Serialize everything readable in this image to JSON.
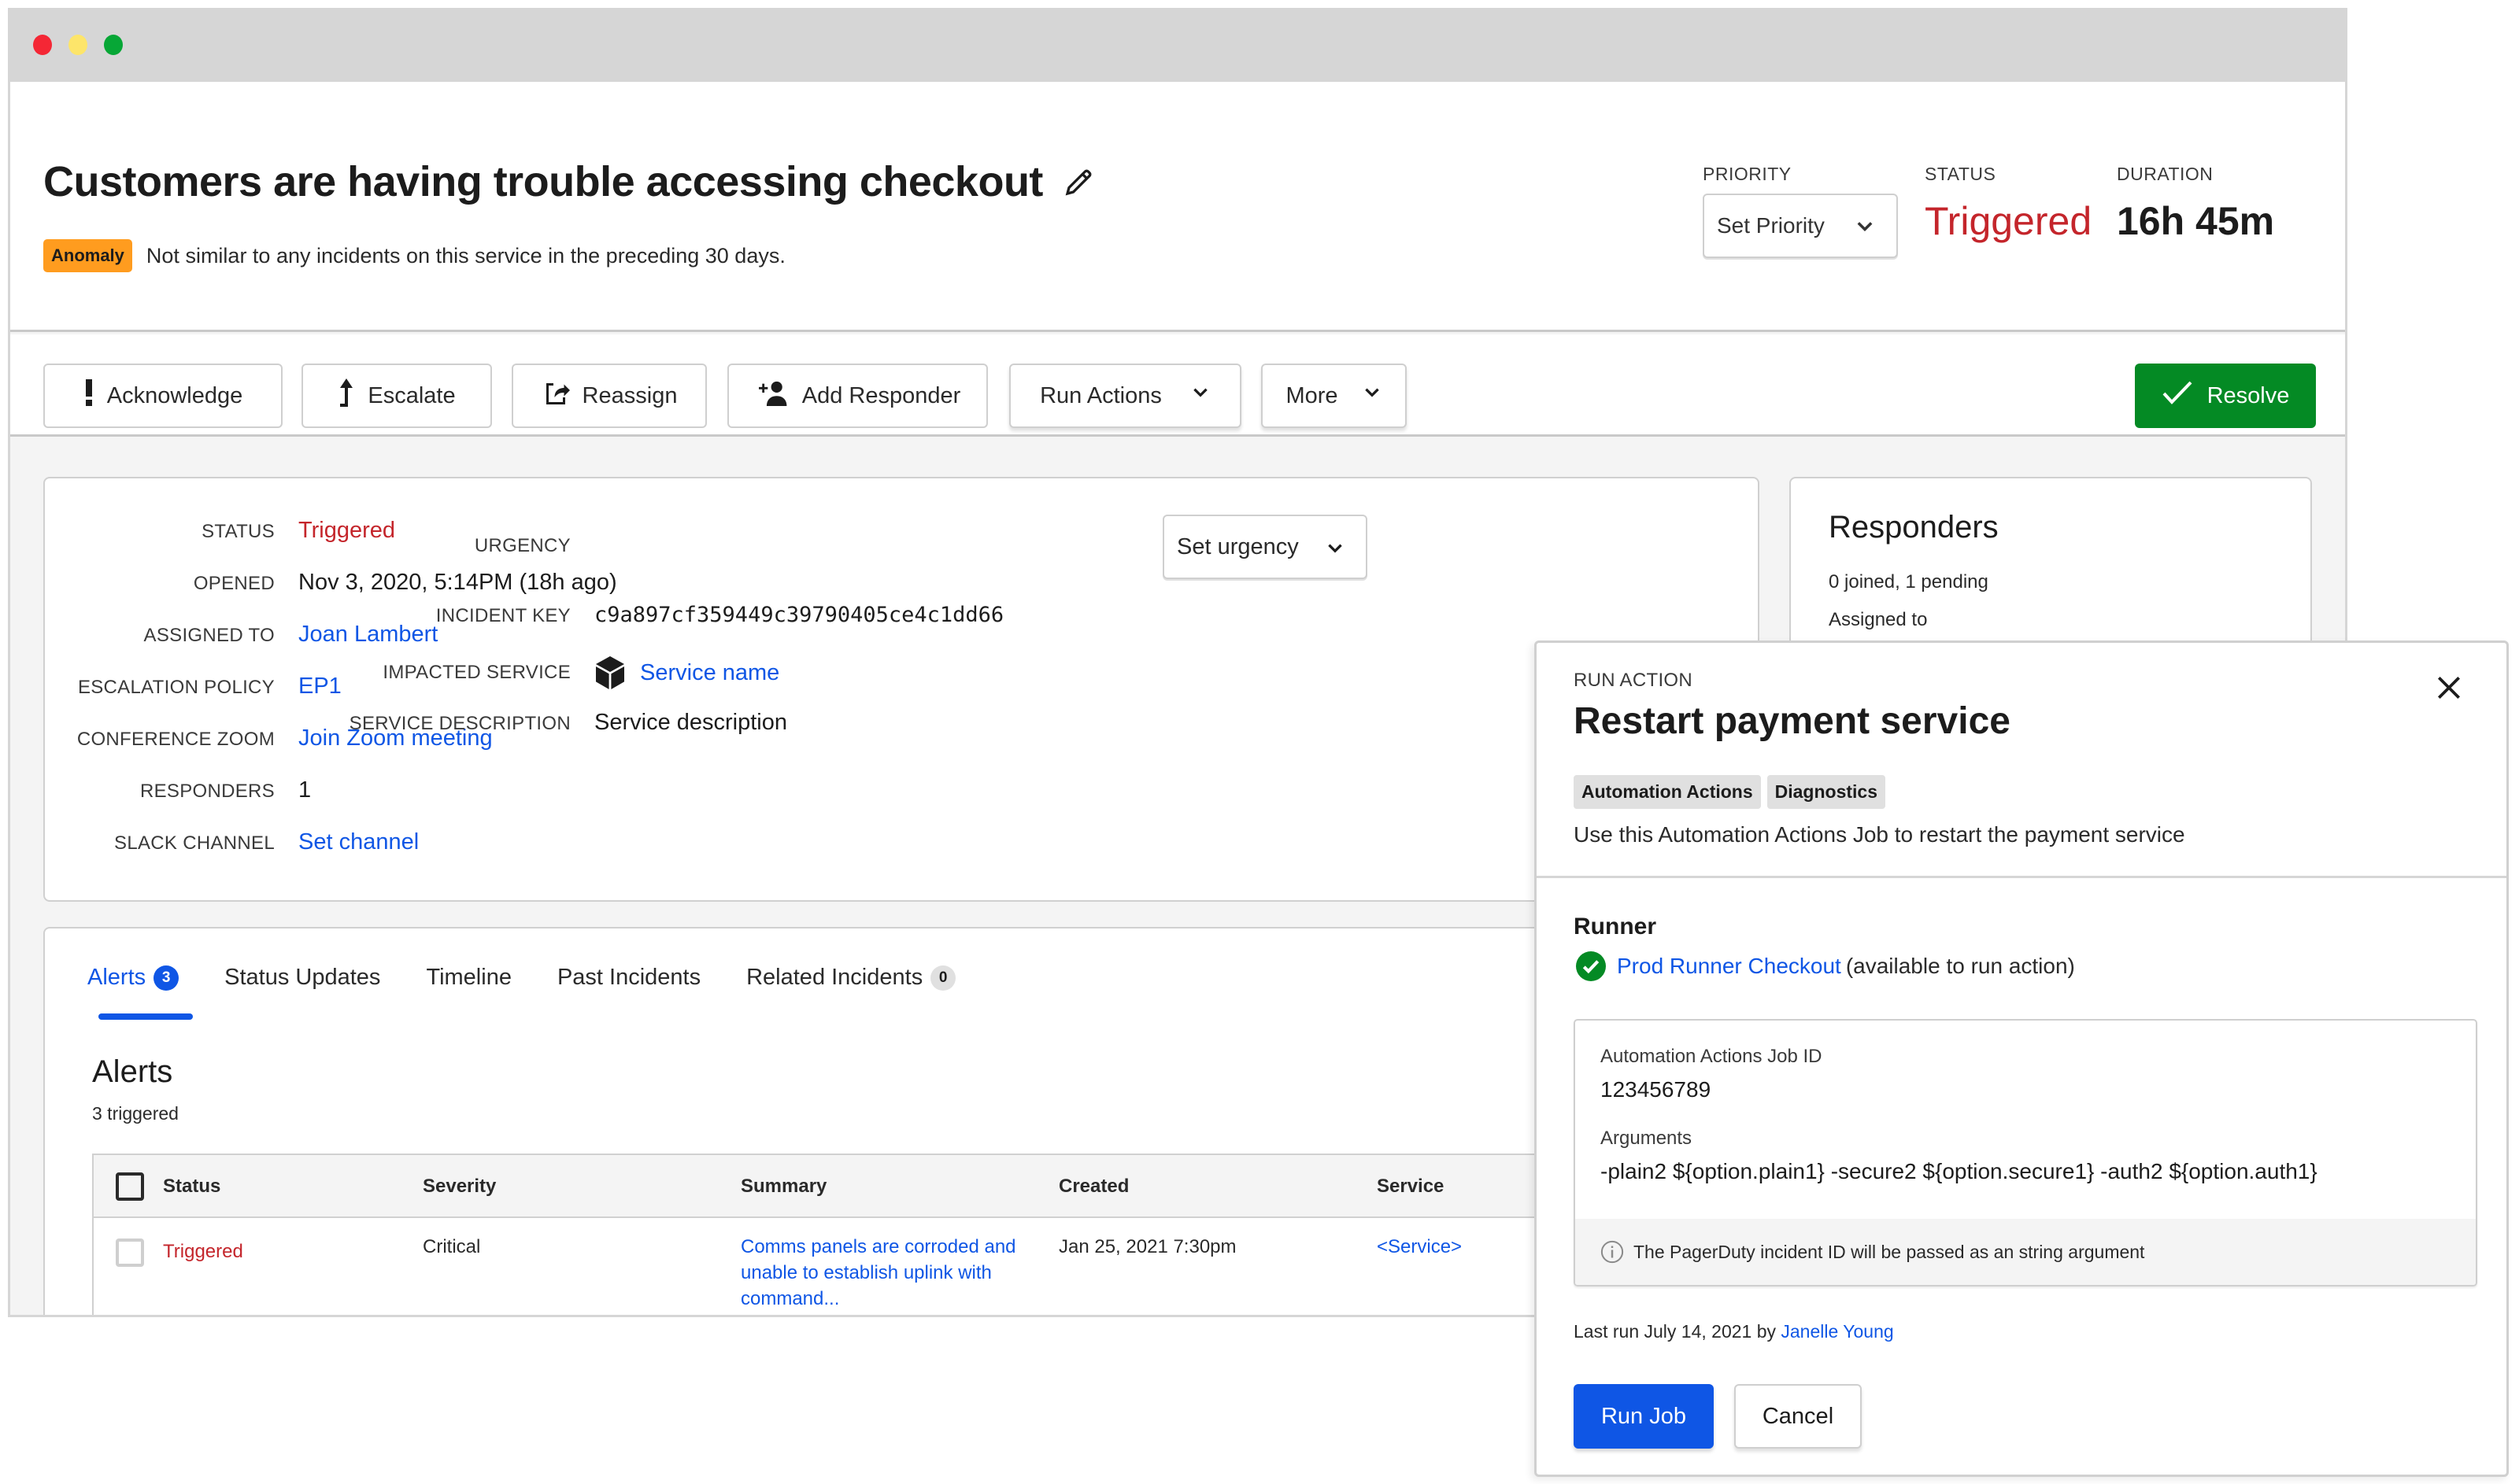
{
  "window": {
    "controls": [
      "close",
      "minimize",
      "maximize"
    ]
  },
  "incident": {
    "title": "Customers are having trouble accessing checkout",
    "edit_icon": "pencil-icon",
    "anomaly_badge": "Anomaly",
    "anomaly_text": "Not similar to any incidents on this service in the preceding 30 days.",
    "priority_label": "PRIORITY",
    "priority_value": "Set Priority",
    "status_label": "STATUS",
    "status_value": "Triggered",
    "duration_label": "DURATION",
    "duration_value": "16h 45m"
  },
  "actions": {
    "acknowledge": "Acknowledge",
    "escalate": "Escalate",
    "reassign": "Reassign",
    "add_responder": "Add Responder",
    "run_actions": "Run Actions",
    "more": "More",
    "resolve": "Resolve"
  },
  "details": {
    "left": [
      {
        "label": "STATUS",
        "value": "Triggered",
        "style": "red"
      },
      {
        "label": "OPENED",
        "value": "Nov 3, 2020, 5:14PM (18h ago)",
        "style": "plain"
      },
      {
        "label": "ASSIGNED TO",
        "value": "Joan Lambert",
        "style": "link"
      },
      {
        "label": "ESCALATION POLICY",
        "value": "EP1",
        "style": "link"
      },
      {
        "label": "CONFERENCE ZOOM",
        "value": "Join Zoom meeting",
        "style": "link"
      },
      {
        "label": "RESPONDERS",
        "value": "1",
        "style": "plain"
      },
      {
        "label": "SLACK CHANNEL",
        "value": "Set channel",
        "style": "link"
      }
    ],
    "urgency_label": "URGENCY",
    "urgency_value": "Set urgency",
    "incident_key_label": "INCIDENT KEY",
    "incident_key_value": "c9a897cf359449c39790405ce4c1dd66",
    "impacted_service_label": "IMPACTED SERVICE",
    "impacted_service_value": "Service name",
    "service_description_label": "SERVICE DESCRIPTION",
    "service_description_value": "Service description"
  },
  "responders": {
    "title": "Responders",
    "summary": "0 joined, 1 pending",
    "assigned_label": "Assigned to"
  },
  "tabs": [
    {
      "label": "Alerts",
      "count": "3",
      "active": true
    },
    {
      "label": "Status Updates"
    },
    {
      "label": "Timeline"
    },
    {
      "label": "Past Incidents"
    },
    {
      "label": "Related Incidents",
      "count": "0"
    }
  ],
  "alerts": {
    "heading": "Alerts",
    "subheading": "3 triggered",
    "columns": [
      "Status",
      "Severity",
      "Summary",
      "Created",
      "Service"
    ],
    "rows": [
      {
        "status": "Triggered",
        "severity": "Critical",
        "summary": "Comms panels are corroded and unable to establish uplink with command...",
        "created": "Jan 25, 2021 7:30pm",
        "service": "<Service>"
      }
    ]
  },
  "run_action": {
    "eyebrow": "RUN ACTION",
    "title": "Restart payment service",
    "tags": [
      "Automation Actions",
      "Diagnostics"
    ],
    "description": "Use this Automation Actions Job to restart the payment service",
    "runner_heading": "Runner",
    "runner_name": "Prod Runner Checkout",
    "runner_status": "(available to run action)",
    "job_id_label": "Automation Actions Job ID",
    "job_id_value": "123456789",
    "arguments_label": "Arguments",
    "arguments_value": "-plain2 ${option.plain1} -secure2 ${option.secure1} -auth2 ${option.auth1}",
    "note": "The PagerDuty incident ID will be passed as an string argument",
    "last_run_prefix": "Last run July 14, 2021 by",
    "last_run_user": "Janelle Young",
    "run_button": "Run Job",
    "cancel_button": "Cancel"
  },
  "colors": {
    "triggered": "#c4252b",
    "link": "#0f56e5",
    "resolve": "#048a24",
    "anomaly": "#ff9c1f",
    "runner_ok": "#048a24"
  }
}
